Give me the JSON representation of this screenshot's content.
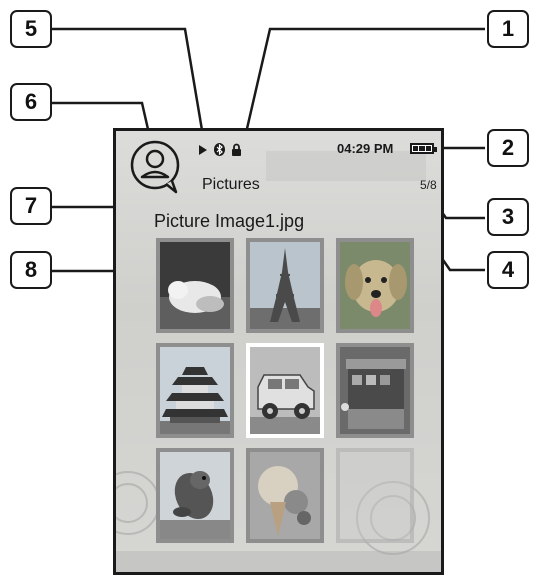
{
  "screen": {
    "title": "Pictures",
    "filename": "Picture Image1.jpg",
    "time": "04:29 PM",
    "page": "5/8",
    "status_icons": [
      "play-icon",
      "bluetooth-icon",
      "lock-icon"
    ],
    "battery_level": 1.0
  },
  "thumbnails": [
    {
      "name": "dog-sleeping-photo",
      "selected": false
    },
    {
      "name": "eiffel-tower-photo",
      "selected": false
    },
    {
      "name": "golden-retriever-photo",
      "selected": false
    },
    {
      "name": "japanese-castle-photo",
      "selected": false
    },
    {
      "name": "vintage-car-photo",
      "selected": true
    },
    {
      "name": "street-stall-photo",
      "selected": false
    },
    {
      "name": "seal-photo",
      "selected": false
    },
    {
      "name": "ice-cream-photo",
      "selected": false
    },
    {
      "name": "empty-slot",
      "selected": false
    }
  ],
  "callouts": [
    "1",
    "2",
    "3",
    "4",
    "5",
    "6",
    "7",
    "8"
  ],
  "colors": {
    "frame": "#1a1a1a",
    "screen_bg": "#d6d6d3",
    "selected_border": "#ffffff"
  }
}
